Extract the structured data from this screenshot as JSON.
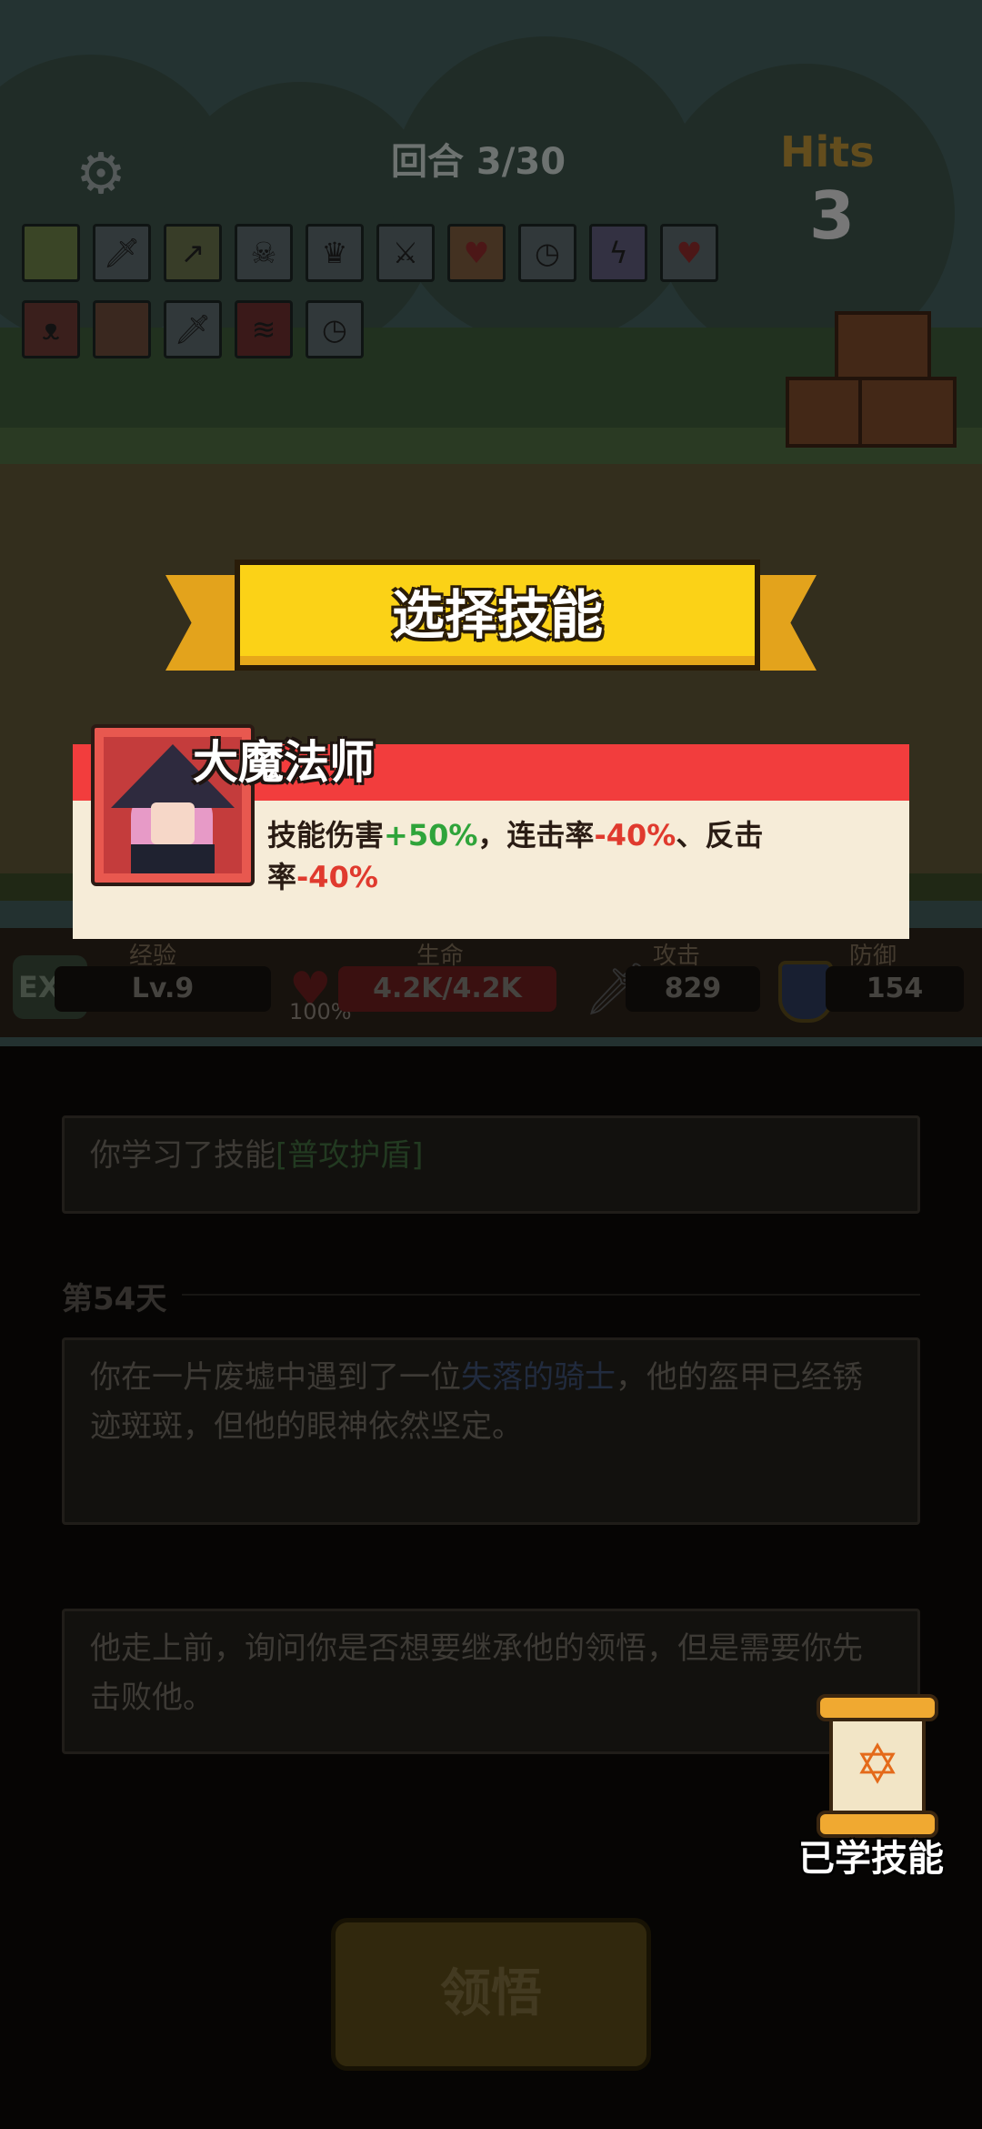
{
  "hud": {
    "round": "回合 3/30",
    "hits_label": "Hits",
    "hits_count": "3",
    "buff_icons": [
      "green-slime-icon",
      "sword-icon",
      "arrow-up-icon",
      "skull-icon",
      "crown-icon",
      "double-sword-icon",
      "heart-icon",
      "clock-icon",
      "lightning-icon",
      "heart-30-icon",
      "fang-icon",
      "frog-icon",
      "sword-icon",
      "fire-icon",
      "clock-icon"
    ]
  },
  "stats": {
    "exp_badge": "EXP",
    "exp_label": "经验",
    "level": "Lv.9",
    "hp_label": "生命",
    "hp": "4.2K/4.2K",
    "hp_percent": "100%",
    "atk_label": "攻击",
    "atk": "829",
    "def_label": "防御",
    "def": "154"
  },
  "dialog": {
    "banner": "选择技能",
    "skill_name": "大魔法师",
    "desc_1": "技能伤害",
    "desc_1_val": "+50%",
    "desc_2": "，连击率",
    "desc_2_val": "-40%",
    "desc_3": "、反击率",
    "desc_3_val": "-40%"
  },
  "log": {
    "entry1_prefix": "你学习了技能",
    "entry1_skill": "[普攻护盾]",
    "day": "第54天",
    "entry2_prefix": "你在一片废墟中遇到了一位",
    "entry2_name": "失落的骑士",
    "entry2_suffix": "，他的盔甲已经锈迹斑斑，但他的眼神依然坚定。",
    "entry3": "他走上前，询问你是否想要继承他的领悟，但是需要你先击败他。"
  },
  "learned_skills_label": "已学技能",
  "action_button": "领悟"
}
